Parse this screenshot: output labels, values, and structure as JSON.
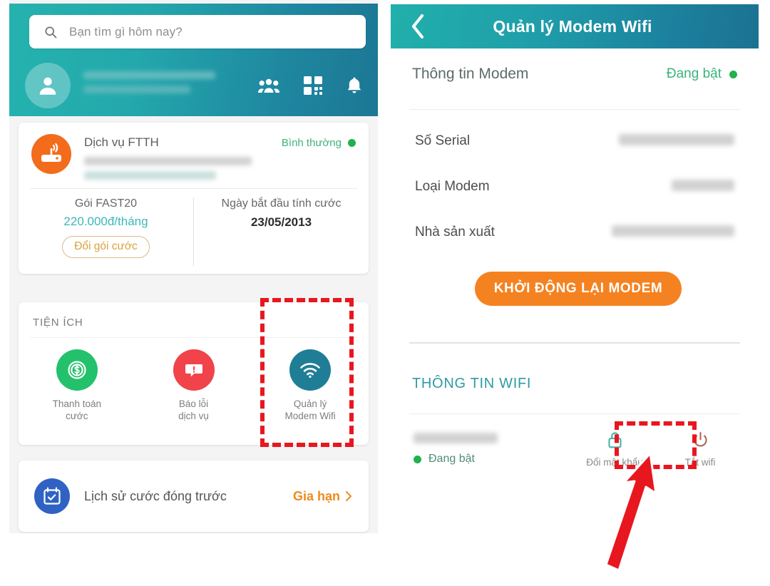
{
  "left_screen": {
    "search": {
      "placeholder": "Bạn tìm gì hôm nay?",
      "icon": "search-icon"
    },
    "header_icons": [
      {
        "name": "contacts-icon",
        "label": "Danh bạ"
      },
      {
        "name": "qr-code-icon",
        "label": "QR"
      },
      {
        "name": "bell-icon",
        "label": "Thông báo"
      }
    ],
    "service_card": {
      "title": "Dịch vụ FTTH",
      "status": "Bình thường",
      "status_color": "#22b14c",
      "icon": "router-icon",
      "icon_bg": "#f26c1c",
      "plan_name": "Gói FAST20",
      "plan_price": "220.000đ/tháng",
      "plan_price_color": "#3cb7bb",
      "change_plan_button": "Đổi gói cước",
      "billing_label": "Ngày bắt đầu tính cước",
      "billing_date": "23/05/2013"
    },
    "utilities": {
      "title": "TIỆN ÍCH",
      "items": [
        {
          "label_line1": "Thanh toán",
          "label_line2": "cước",
          "icon": "dollar-coin-icon",
          "color": "#23c16b"
        },
        {
          "label_line1": "Báo lỗi",
          "label_line2": "dịch vụ",
          "icon": "alert-message-icon",
          "color": "#f0434a"
        },
        {
          "label_line1": "Quản lý",
          "label_line2": "Modem Wifi",
          "icon": "wifi-icon",
          "color": "#1f7e96"
        }
      ]
    },
    "history_card": {
      "label": "Lịch sử cước đóng trước",
      "action": "Gia hạn",
      "action_color": "#ee8b1c",
      "icon": "calendar-check-icon"
    }
  },
  "right_screen": {
    "header": {
      "title": "Quản lý Modem Wifi",
      "back_icon": "chevron-left-icon"
    },
    "modem_info": {
      "section_title": "Thông tin Modem",
      "status": "Đang bật",
      "status_color": "#22b14c",
      "rows": [
        {
          "label": "Số Serial",
          "value": ""
        },
        {
          "label": "Loại Modem",
          "value": ""
        },
        {
          "label": "Nhà sản xuất",
          "value": ""
        }
      ],
      "restart_button": "KHỞI ĐỘNG LẠI MODEM",
      "restart_button_color": "#f58220"
    },
    "wifi_info": {
      "section_title": "THÔNG TIN WIFI",
      "section_title_color": "#2f9aa6",
      "ssid": "",
      "status": "Đang bật",
      "actions": [
        {
          "label": "Đổi mật khẩu",
          "icon": "lock-icon",
          "color": "#4db6ac"
        },
        {
          "label": "Tắt wifi",
          "icon": "power-icon",
          "color": "#a96a5a"
        }
      ]
    }
  },
  "annotations": {
    "highlight_color": "#e8171f",
    "boxes": [
      {
        "target": "Quản lý Modem Wifi"
      },
      {
        "target": "Đổi mật khẩu"
      }
    ],
    "arrow": {
      "points_to": "Đổi mật khẩu"
    }
  }
}
